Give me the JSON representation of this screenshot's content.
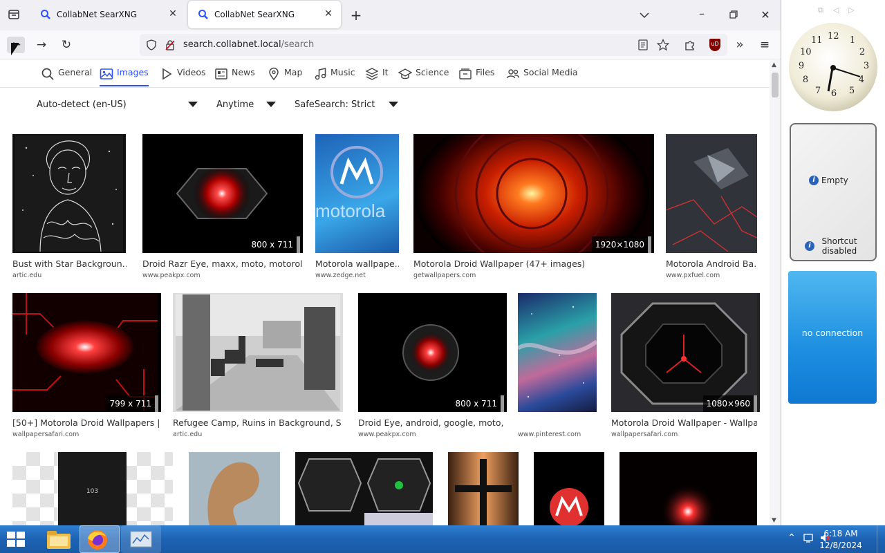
{
  "browser": {
    "tabs": [
      {
        "title": "CollabNet SearXNG",
        "active": false
      },
      {
        "title": "CollabNet SearXNG",
        "active": true
      }
    ],
    "url_host": "search.collabnet.local",
    "url_path": "/search"
  },
  "categories": [
    {
      "label": "General",
      "icon": "search-icon",
      "active": false
    },
    {
      "label": "Images",
      "icon": "image-icon",
      "active": true
    },
    {
      "label": "Videos",
      "icon": "play-icon",
      "active": false
    },
    {
      "label": "News",
      "icon": "newspaper-icon",
      "active": false
    },
    {
      "label": "Map",
      "icon": "map-pin-icon",
      "active": false
    },
    {
      "label": "Music",
      "icon": "music-note-icon",
      "active": false
    },
    {
      "label": "It",
      "icon": "layers-icon",
      "active": false
    },
    {
      "label": "Science",
      "icon": "graduation-cap-icon",
      "active": false
    },
    {
      "label": "Files",
      "icon": "folder-icon",
      "active": false
    },
    {
      "label": "Social Media",
      "icon": "people-icon",
      "active": false
    }
  ],
  "filters": {
    "language": "Auto-detect (en-US)",
    "time": "Anytime",
    "safesearch": "SafeSearch: Strict"
  },
  "results": [
    {
      "title": "Bust with Star Backgroun…",
      "domain": "artic.edu",
      "size": ""
    },
    {
      "title": "Droid Razr Eye, maxx, moto, motorol…",
      "domain": "www.peakpx.com",
      "size": "800 x 711"
    },
    {
      "title": "Motorola wallpape…",
      "domain": "www.zedge.net",
      "size": ""
    },
    {
      "title": "Motorola Droid Wallpaper (47+ images)",
      "domain": "getwallpapers.com",
      "size": "1920×1080"
    },
    {
      "title": "Motorola Android Ba…",
      "domain": "www.pxfuel.com",
      "size": ""
    },
    {
      "title": "[50+] Motorola Droid Wallpapers | …",
      "domain": "wallpapersafari.com",
      "size": "799 x 711"
    },
    {
      "title": "Refugee Camp, Ruins in Background, S…",
      "domain": "artic.edu",
      "size": ""
    },
    {
      "title": "Droid Eye, android, google, moto, …",
      "domain": "www.peakpx.com",
      "size": "800 x 711"
    },
    {
      "title": "",
      "domain": "www.pinterest.com",
      "size": ""
    },
    {
      "title": "Motorola Droid Wallpaper - Wallpa…",
      "domain": "wallpapersafari.com",
      "size": "1080×960"
    },
    {
      "title": "",
      "domain": "",
      "size": ""
    },
    {
      "title": "",
      "domain": "",
      "size": ""
    },
    {
      "title": "",
      "domain": "",
      "size": ""
    },
    {
      "title": "",
      "domain": "",
      "size": ""
    },
    {
      "title": "",
      "domain": "",
      "size": ""
    },
    {
      "title": "",
      "domain": "",
      "size": ""
    }
  ],
  "phone_thumb_text": "103",
  "motorola_thumb_text": "motorola",
  "gadgets": {
    "clock_numbers": [
      "12",
      "1",
      "2",
      "3",
      "4",
      "5",
      "6",
      "7",
      "8",
      "9",
      "10",
      "11"
    ],
    "slideshow_empty": "Empty",
    "shortcut_disabled": "Shortcut disabled",
    "weather_status": "no connection"
  },
  "taskbar": {
    "time": "6:18 AM",
    "date": "12/8/2024"
  },
  "colors": {
    "accent": "#3050ff",
    "taskbar": "#1d62b3"
  }
}
